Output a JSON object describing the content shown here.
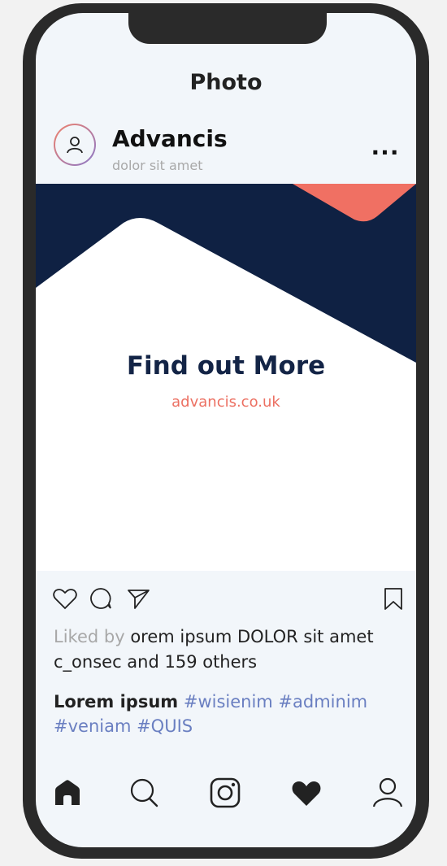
{
  "header": {
    "title": "Photo"
  },
  "profile": {
    "name": "Advancis",
    "subtitle": "dolor sit amet",
    "more_label": "..."
  },
  "post": {
    "headline": "Find out More",
    "link": "advancis.co.uk"
  },
  "likes": {
    "prefix": "Liked by",
    "text": "orem ipsum DOLOR sit amet c_onsec and 159 others"
  },
  "caption": {
    "user": "Lorem ipsum",
    "tags": "#wisienim #adminim #veniam #QUIS"
  },
  "colors": {
    "navy": "#0f2143",
    "coral": "#f07063",
    "tag": "#6a7fc1"
  },
  "icons": {
    "actions": [
      "heart-outline-icon",
      "comment-icon",
      "send-icon",
      "bookmark-icon"
    ],
    "nav": [
      "home-icon",
      "search-icon",
      "instagram-icon",
      "heart-filled-icon",
      "profile-icon"
    ]
  }
}
